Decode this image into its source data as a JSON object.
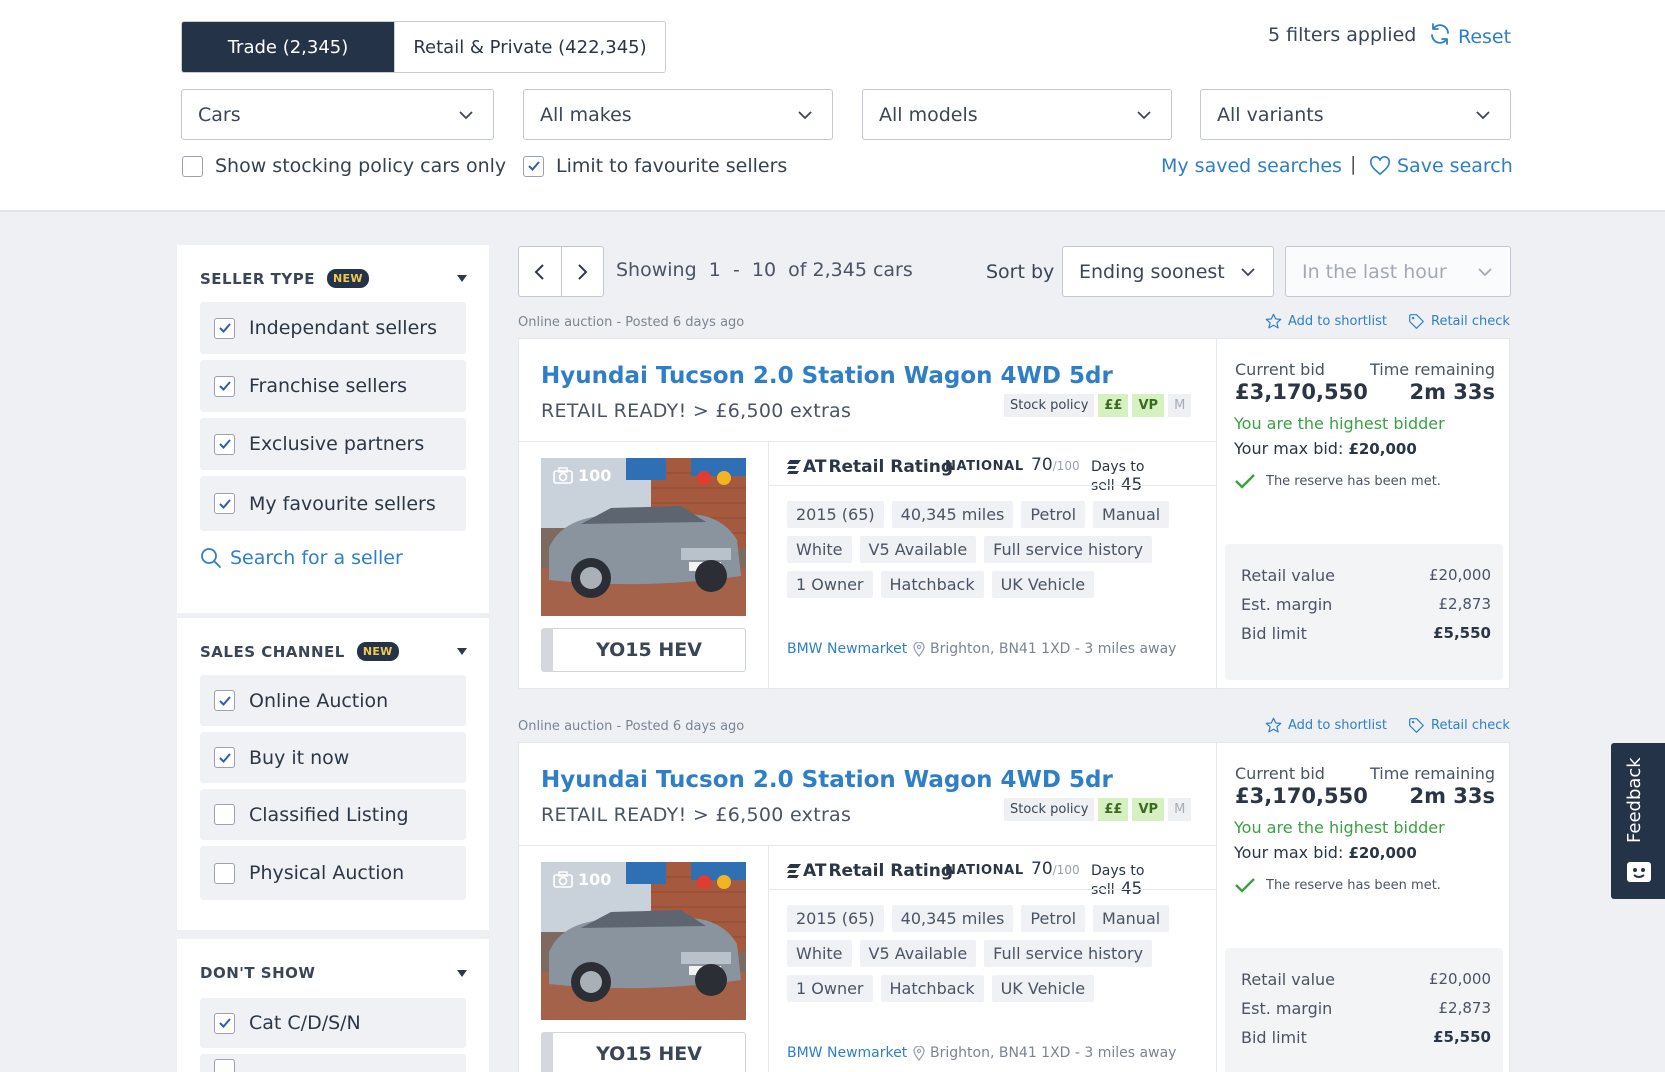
{
  "tabs": {
    "trade": "Trade (2,345)",
    "retail": "Retail & Private (422,345)"
  },
  "filters": {
    "applied": "5 filters applied",
    "reset": "Reset"
  },
  "dropdowns": {
    "type": "Cars",
    "makes": "All makes",
    "models": "All models",
    "variants": "All variants"
  },
  "options": {
    "stocking_policy": "Show stocking policy cars only",
    "favourite_sellers": "Limit to favourite sellers"
  },
  "saved": {
    "my_saved": "My saved searches",
    "divider": "|",
    "save": "Save search"
  },
  "sidebar": {
    "badge_new": "NEW",
    "seller_type": {
      "title": "SELLER TYPE",
      "items": [
        "Independant sellers",
        "Franchise sellers",
        "Exclusive partners",
        "My favourite sellers"
      ],
      "checked": [
        true,
        true,
        true,
        true
      ],
      "search": "Search for a seller"
    },
    "sales_channel": {
      "title": "SALES CHANNEL",
      "items": [
        "Online Auction",
        "Buy it now",
        "Classified Listing",
        "Physical Auction"
      ],
      "checked": [
        true,
        true,
        false,
        false
      ]
    },
    "dont_show": {
      "title": "DON'T SHOW",
      "items": [
        "Cat C/D/S/N"
      ],
      "checked": [
        true
      ]
    }
  },
  "results": {
    "showing": "Showing",
    "range_from": "1",
    "range_sep": "-",
    "range_to": "10",
    "of_total": "of 2,345 cars",
    "sort_label": "Sort by",
    "sort_value": "Ending soonest",
    "time_filter": "In the last hour"
  },
  "listings": [
    {
      "posted": "Online auction - Posted 6 days ago",
      "shortlist": "Add to shortlist",
      "retail_check": "Retail check",
      "title": "Hyundai Tucson 2.0 Station Wagon 4WD 5dr",
      "subtitle": "RETAIL READY! > £6,500 extras",
      "policy": {
        "label": "Stock policy",
        "tags": [
          "££",
          "VP",
          "M"
        ]
      },
      "photo_count": "100",
      "plate": "YO15 HEV",
      "rating": {
        "logo": "AT",
        "label": "Retail Rating",
        "scope": "NATIONAL",
        "score": "70",
        "out_of": "/100",
        "days_label": "Days to sell",
        "days": "45"
      },
      "specs": [
        "2015 (65)",
        "40,345 miles",
        "Petrol",
        "Manual",
        "White",
        "V5 Available",
        "Full service history",
        "1 Owner",
        "Hatchback",
        "UK Vehicle"
      ],
      "dealer": "BMW Newmarket",
      "location": "Brighton, BN41 1XD - 3 miles away",
      "bid": {
        "current_label": "Current bid",
        "current": "£3,170,550",
        "time_label": "Time remaining",
        "time": "2m 33s",
        "status": "You are the highest bidder",
        "max_label": "Your max bid:",
        "max": "£20,000",
        "reserve": "The reserve has been met."
      },
      "values": {
        "retail_label": "Retail value",
        "retail": "£20,000",
        "margin_label": "Est. margin",
        "margin": "£2,873",
        "limit_label": "Bid limit",
        "limit": "£5,550"
      }
    },
    {
      "posted": "Online auction - Posted 6 days ago",
      "shortlist": "Add to shortlist",
      "retail_check": "Retail check",
      "title": "Hyundai Tucson 2.0 Station Wagon 4WD 5dr",
      "subtitle": "RETAIL READY! > £6,500 extras",
      "policy": {
        "label": "Stock policy",
        "tags": [
          "££",
          "VP",
          "M"
        ]
      },
      "photo_count": "100",
      "plate": "YO15 HEV",
      "rating": {
        "logo": "AT",
        "label": "Retail Rating",
        "scope": "NATIONAL",
        "score": "70",
        "out_of": "/100",
        "days_label": "Days to sell",
        "days": "45"
      },
      "specs": [
        "2015 (65)",
        "40,345 miles",
        "Petrol",
        "Manual",
        "White",
        "V5 Available",
        "Full service history",
        "1 Owner",
        "Hatchback",
        "UK Vehicle"
      ],
      "dealer": "BMW Newmarket",
      "location": "Brighton, BN41 1XD - 3 miles away",
      "bid": {
        "current_label": "Current bid",
        "current": "£3,170,550",
        "time_label": "Time remaining",
        "time": "2m 33s",
        "status": "You are the highest bidder",
        "max_label": "Your max bid:",
        "max": "£20,000",
        "reserve": "The reserve has been met."
      },
      "values": {
        "retail_label": "Retail value",
        "retail": "£20,000",
        "margin_label": "Est. margin",
        "margin": "£2,873",
        "limit_label": "Bid limit",
        "limit": "£5,550"
      }
    }
  ],
  "feedback": "Feedback",
  "colors": {
    "navy": "#253349",
    "link": "#2e7fc7",
    "success": "#3aa142",
    "badge_text": "#f2c94c"
  }
}
